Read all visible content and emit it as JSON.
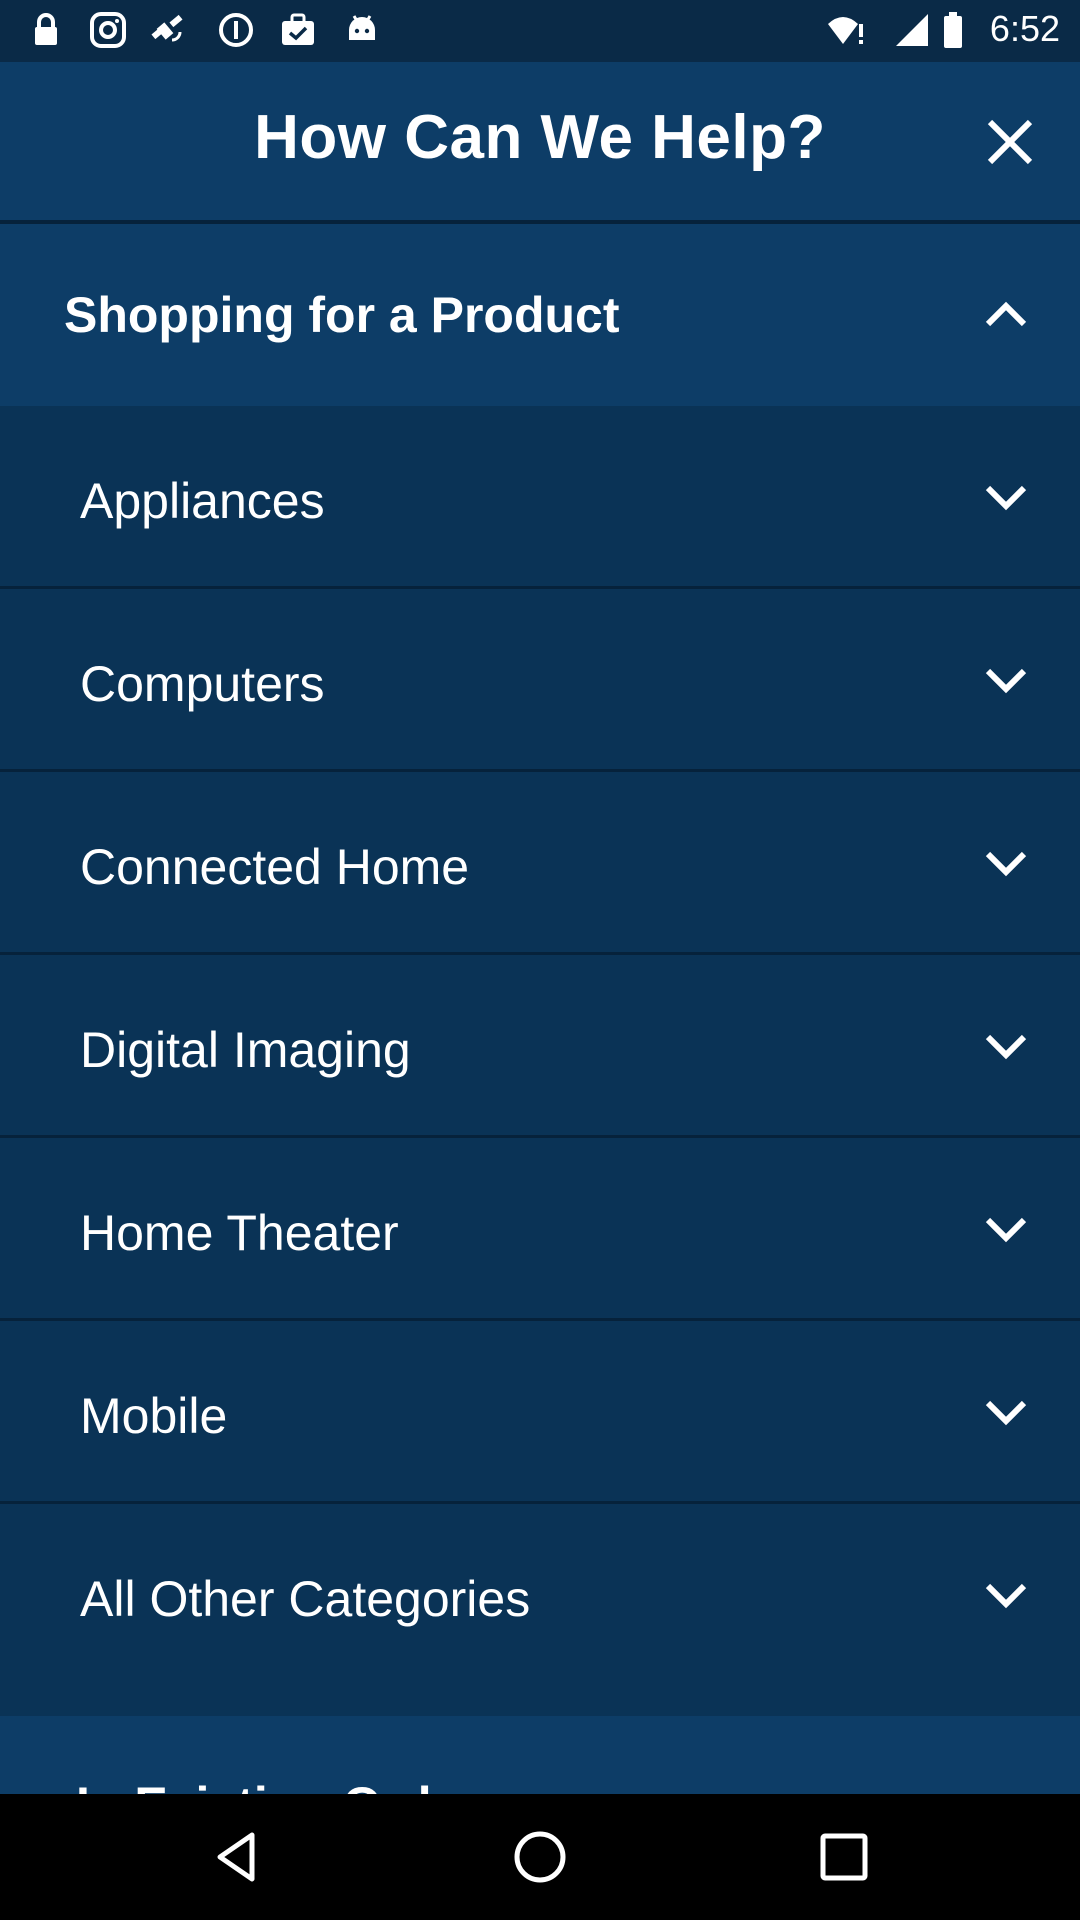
{
  "status_bar": {
    "time": "6:52",
    "icons": [
      "lock-icon",
      "instagram-icon",
      "fake-gps-icon",
      "info-icon",
      "briefcase-check-icon",
      "android-icon",
      "wifi-alert-icon",
      "signal-icon",
      "battery-icon"
    ]
  },
  "header": {
    "title": "How Can We Help?",
    "close_icon": "close-icon"
  },
  "section": {
    "title": "Shopping for a Product",
    "expanded": true,
    "chevron_icon": "chevron-up-icon"
  },
  "items": [
    {
      "label": "Appliances",
      "icon": "chevron-down-icon"
    },
    {
      "label": "Computers",
      "icon": "chevron-down-icon"
    },
    {
      "label": "Connected Home",
      "icon": "chevron-down-icon"
    },
    {
      "label": "Digital Imaging",
      "icon": "chevron-down-icon"
    },
    {
      "label": "Home Theater",
      "icon": "chevron-down-icon"
    },
    {
      "label": "Mobile",
      "icon": "chevron-down-icon"
    },
    {
      "label": "All Other Categories",
      "icon": "chevron-down-icon"
    }
  ],
  "next_section": {
    "title": "In Existing Order"
  },
  "nav": {
    "back_icon": "back-icon",
    "home_icon": "home-icon",
    "recents_icon": "recents-icon"
  },
  "colors": {
    "background": "#0a3356",
    "header": "#0d3d67",
    "divider": "#06223b",
    "text": "#ffffff"
  }
}
